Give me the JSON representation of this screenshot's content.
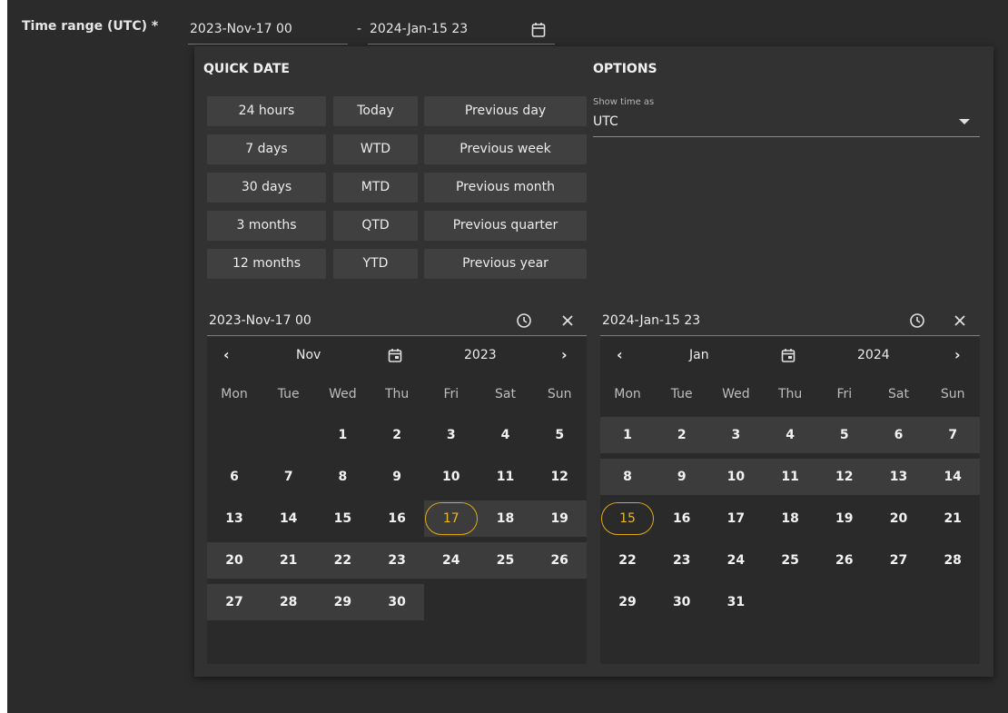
{
  "field": {
    "label": "Time range (UTC) *",
    "start_value": "2023-Nov-17 00",
    "separator": "-",
    "end_value": "2024-Jan-15 23"
  },
  "quick_date": {
    "title": "QUICK DATE",
    "col1": [
      "24 hours",
      "7 days",
      "30 days",
      "3 months",
      "12 months"
    ],
    "col2": [
      "Today",
      "WTD",
      "MTD",
      "QTD",
      "YTD"
    ],
    "col3": [
      "Previous day",
      "Previous week",
      "Previous month",
      "Previous quarter",
      "Previous year"
    ]
  },
  "options": {
    "title": "OPTIONS",
    "show_time_label": "Show time as",
    "show_time_value": "UTC"
  },
  "weekdays": [
    "Mon",
    "Tue",
    "Wed",
    "Thu",
    "Fri",
    "Sat",
    "Sun"
  ],
  "left_calendar": {
    "input_value": "2023-Nov-17 00",
    "month": "Nov",
    "year": "2023",
    "weeks": [
      [
        "",
        "",
        "1",
        "2",
        "3",
        "4",
        "5"
      ],
      [
        "6",
        "7",
        "8",
        "9",
        "10",
        "11",
        "12"
      ],
      [
        "13",
        "14",
        "15",
        "16",
        "17",
        "18",
        "19"
      ],
      [
        "20",
        "21",
        "22",
        "23",
        "24",
        "25",
        "26"
      ],
      [
        "27",
        "28",
        "29",
        "30",
        "",
        "",
        ""
      ]
    ],
    "selected_day": "17"
  },
  "right_calendar": {
    "input_value": "2024-Jan-15 23",
    "month": "Jan",
    "year": "2024",
    "weeks": [
      [
        "1",
        "2",
        "3",
        "4",
        "5",
        "6",
        "7"
      ],
      [
        "8",
        "9",
        "10",
        "11",
        "12",
        "13",
        "14"
      ],
      [
        "15",
        "16",
        "17",
        "18",
        "19",
        "20",
        "21"
      ],
      [
        "22",
        "23",
        "24",
        "25",
        "26",
        "27",
        "28"
      ],
      [
        "29",
        "30",
        "31",
        "",
        "",
        "",
        ""
      ]
    ],
    "selected_day": "15"
  },
  "colors": {
    "background": "#2b2b2b",
    "panel": "#323232",
    "button": "#404040",
    "range_highlight": "#3c3c3c",
    "selected_accent": "#e0a817"
  },
  "icons": {
    "open_calendar": "calendar-icon",
    "time": "clock-icon",
    "clear": "close-icon",
    "prev": "chevron-left-icon",
    "next": "chevron-right-icon",
    "dropdown": "caret-down-icon"
  }
}
